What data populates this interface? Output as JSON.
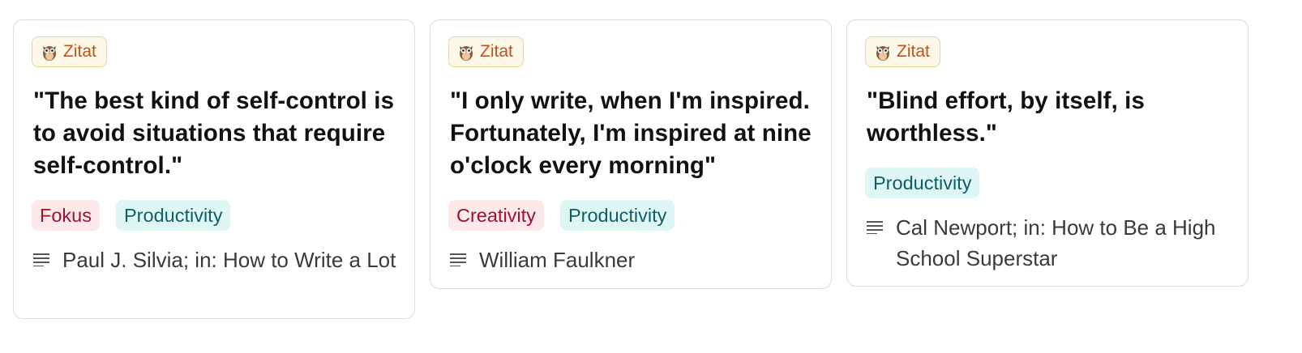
{
  "cards": [
    {
      "type_label": "Zitat",
      "quote": "\"The best kind of self-control is to avoid situations that require self-control.\"",
      "tags": [
        "Fokus",
        "Productivity"
      ],
      "source": "Paul J. Silvia; in: How to Write a Lot"
    },
    {
      "type_label": "Zitat",
      "quote": "\"I only write, when I'm inspired. Fortunately, I'm inspired at nine o'clock every morning\"",
      "tags": [
        "Creativity",
        "Productivity"
      ],
      "source": "William Faulkner"
    },
    {
      "type_label": "Zitat",
      "quote": "\"Blind effort, by itself, is worthless.\"",
      "tags": [
        "Productivity"
      ],
      "source": "Cal Newport; in: How to Be a High School Superstar"
    }
  ],
  "icons": {
    "type_badge": "owl-icon",
    "source": "text-lines-icon"
  },
  "colors": {
    "badge_bg": "#fdf8e8",
    "badge_border": "#f0d48a",
    "badge_text": "#c2521b",
    "tag_red_bg": "#fde8ea",
    "tag_red_text": "#9c1232",
    "tag_teal_bg": "#def7f4",
    "tag_teal_text": "#115e64"
  }
}
